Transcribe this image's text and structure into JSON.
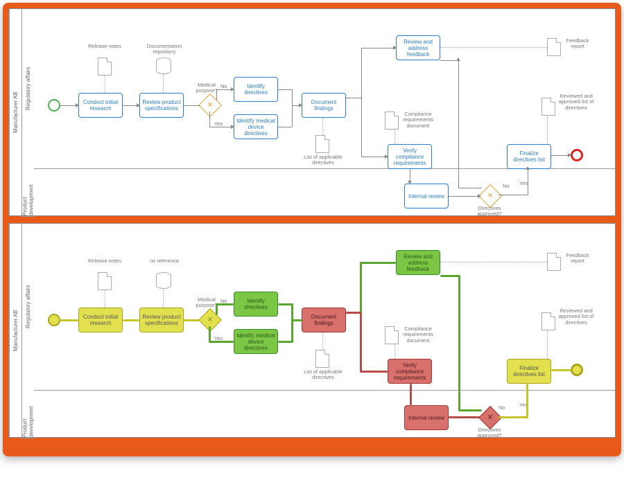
{
  "pool": "Manufacturer AB",
  "lanes": {
    "regulatory": "Regulatory affairs",
    "product": "Product development"
  },
  "artifacts": {
    "release_notes": "Release notes",
    "doc_repo": "Documentation repository",
    "no_reference": "no reference",
    "list_directives": "List of applicable directives",
    "compliance_doc": "Compliance requirements document",
    "feedback_report": "Feedback report",
    "reviewed_list": "Reviewed and approved list of directives"
  },
  "gateways": {
    "medical": "Medical purpose?",
    "approved": "Directives approved?"
  },
  "edges": {
    "no": "No",
    "yes": "Yes"
  },
  "tasks": {
    "t1": "Conduct initial research",
    "t2": "Review product specifications",
    "t3": "Identify directives",
    "t4": "Identify medical device directives",
    "t5": "Document findings",
    "t6": "Review and address feedback",
    "t7": "Verify compliance requirements",
    "t8": "Internal review",
    "t9": "Finalize directives list"
  }
}
